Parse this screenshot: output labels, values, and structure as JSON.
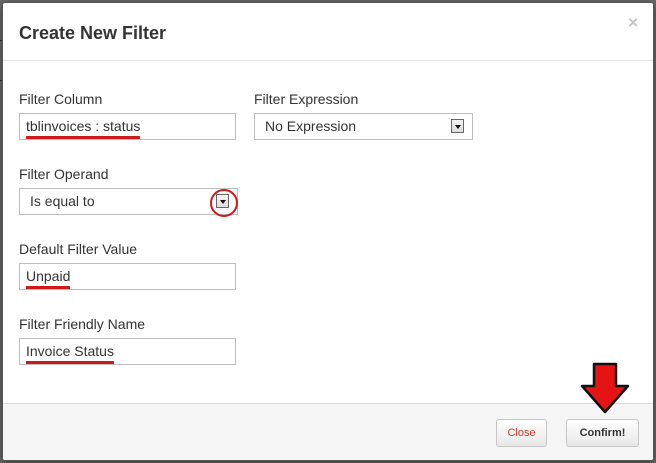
{
  "dialog": {
    "title": "Create New Filter",
    "close_symbol": "×"
  },
  "form": {
    "filter_column": {
      "label": "Filter Column",
      "value": "tblinvoices : status"
    },
    "filter_expression": {
      "label": "Filter Expression",
      "selected": "No Expression"
    },
    "filter_operand": {
      "label": "Filter Operand",
      "selected": "Is equal to"
    },
    "default_value": {
      "label": "Default Filter Value",
      "value": "Unpaid"
    },
    "friendly_name": {
      "label": "Filter Friendly Name",
      "value": "Invoice Status"
    }
  },
  "footer": {
    "close_label": "Close",
    "confirm_label": "Confirm!"
  },
  "annotations": {
    "highlight_color": "#cc1a1a",
    "arrow_icon": "down-arrow-icon",
    "circle_icon": "highlight-circle"
  }
}
